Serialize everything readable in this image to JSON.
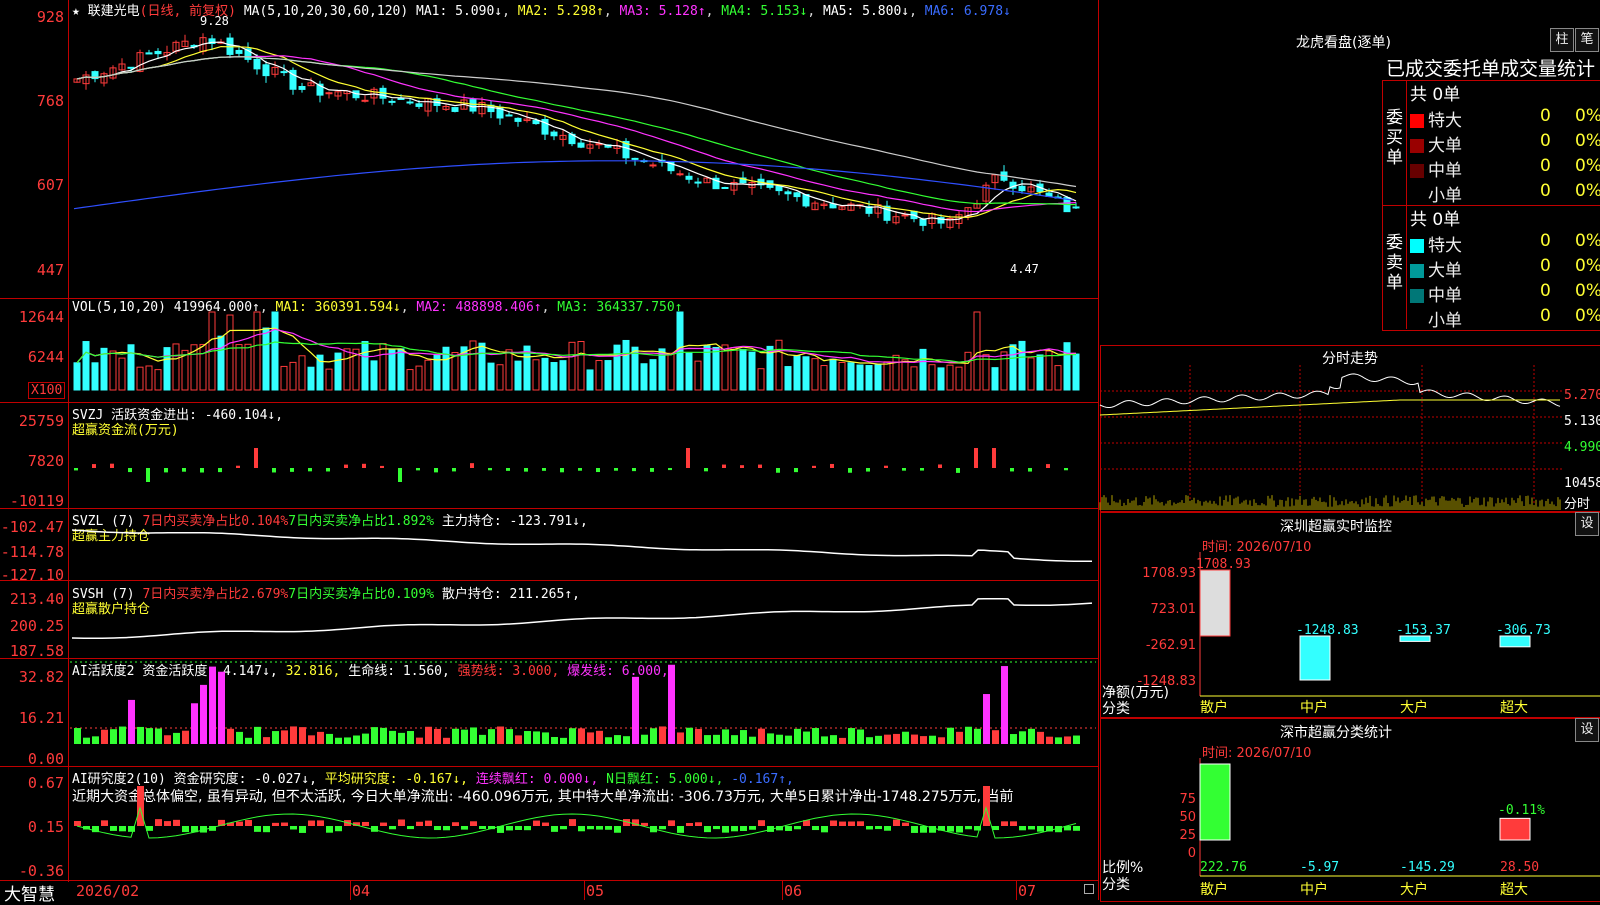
{
  "app": {
    "brand": "大智慧"
  },
  "main": {
    "header": {
      "name": "联建光电",
      "mode": "(日线, 前复权)",
      "ma_title": "MA(5,10,20,30,60,120)",
      "ma1": "MA1: 5.090↓",
      "ma2": "MA2: 5.298↑",
      "ma3": "MA3: 5.128↑",
      "ma4": "MA4: 5.153↓",
      "ma5": "MA5: 5.800↓",
      "ma6": "MA6: 6.978↓"
    },
    "yaxis": [
      "928",
      "768",
      "607",
      "447"
    ],
    "high_label": "9.28",
    "low_label": "4.47",
    "colors": {
      "up": "#ff3b3b",
      "down": "#33ffff",
      "ma1": "#ffffff",
      "ma2": "#ffff33",
      "ma3": "#ff33ff",
      "ma4": "#33ff33",
      "ma5": "#cccccc",
      "ma6": "#2f4fff"
    }
  },
  "vol": {
    "header": {
      "title": "VOL(5,10,20)",
      "value": "419964.000↑",
      "ma1": "MA1: 360391.594↓",
      "ma2": "MA2: 488898.406↑",
      "ma3": "MA3: 364337.750↑"
    },
    "yaxis": [
      "12644",
      "6244"
    ],
    "unit": "X100"
  },
  "svzj": {
    "header": {
      "title": "SVZJ",
      "label": "活跃资金进出: -460.104↓,",
      "sub": "超赢资金流(万元)"
    },
    "yaxis": [
      "25759",
      "7820",
      "-10119"
    ]
  },
  "svzl": {
    "header": {
      "title": "SVZL (7)",
      "a": "7日内买卖净占比0.104%",
      "b": "7日内买卖净占比1.892%",
      "c": "主力持仓: -123.791↓,",
      "sub": "超赢主力持仓"
    },
    "yaxis": [
      "-102.47",
      "-114.78",
      "-127.10"
    ]
  },
  "svsh": {
    "header": {
      "title": "SVSH (7)",
      "a": "7日内买卖净占比2.679%",
      "b": "7日内买卖净占比0.109%",
      "c": "散户持仓: 211.265↑,",
      "sub": "超赢散户持仓"
    },
    "yaxis": [
      "213.40",
      "200.25",
      "187.58"
    ]
  },
  "ai1": {
    "header": {
      "title": "AI活跃度2",
      "a": "资金活跃度: 4.147↓,",
      "b": "32.816,",
      "c": "生命线: 1.560,",
      "d": "强势线: 3.000,",
      "e": "爆发线: 6.000,"
    },
    "yaxis": [
      "32.82",
      "16.21",
      "0.00"
    ]
  },
  "ai2": {
    "header": {
      "title": "AI研究度2(10)",
      "a": "资金研究度: -0.027↓,",
      "b": "平均研究度: -0.167↓,",
      "c": "连续飘红: 0.000↓,",
      "d": "N日飘红: 5.000↓,",
      "e": "-0.167↑,"
    },
    "text": "近期大资金总体偏空, 虽有异动, 但不太活跃, 今日大单净流出: -460.096万元, 其中特大单净流出: -306.73万元, 大单5日累计净出-1748.275万元, 当前",
    "yaxis": [
      "0.67",
      "0.15",
      "-0.36"
    ]
  },
  "xaxis": [
    "2026/02",
    "04",
    "05",
    "06",
    "07"
  ],
  "right": {
    "lhb": {
      "title": "龙虎看盘(逐单)",
      "btn_bar": "柱",
      "btn_pen": "笔",
      "subtitle": "已成交委托单成交量统计",
      "buy_label": "委买单",
      "sell_label": "委卖单",
      "buy_total": "共 0单",
      "sell_total": "共 0单",
      "buy_rows": [
        {
          "name": "特大",
          "val": "0",
          "pct": "0%",
          "color": "#ff0000"
        },
        {
          "name": "大单",
          "val": "0",
          "pct": "0%",
          "color": "#990000"
        },
        {
          "name": "中单",
          "val": "0",
          "pct": "0%",
          "color": "#660000"
        },
        {
          "name": "小单",
          "val": "0",
          "pct": "0%",
          "color": ""
        }
      ],
      "sell_rows": [
        {
          "name": "特大",
          "val": "0",
          "pct": "0%",
          "color": "#00ffff"
        },
        {
          "name": "大单",
          "val": "0",
          "pct": "0%",
          "color": "#009999"
        },
        {
          "name": "中单",
          "val": "0",
          "pct": "0%",
          "color": "#007777"
        },
        {
          "name": "小单",
          "val": "0",
          "pct": "0%",
          "color": ""
        }
      ]
    },
    "fs": {
      "title": "分时走势",
      "p1": "5.270",
      "p2": "5.130",
      "p3": "4.990",
      "v": "10458",
      "unit": "分时"
    },
    "sz": {
      "title": "深圳超赢实时监控",
      "btn": "设",
      "time": "时间: 2026/07/10",
      "yaxis": [
        "1708.93",
        "723.01",
        "-262.91",
        "-1248.83"
      ],
      "ylabel1": "净额(万元)",
      "ylabel2": "分类",
      "bars": [
        {
          "cat": "散户",
          "label": "1708.93",
          "value": 1708.93
        },
        {
          "cat": "中户",
          "label": "-1248.83",
          "value": -1248.83
        },
        {
          "cat": "大户",
          "label": "-153.37",
          "value": -153.37
        },
        {
          "cat": "超大",
          "label": "-306.73",
          "value": -306.73
        }
      ]
    },
    "ss": {
      "title": "深市超赢分类统计",
      "btn": "设",
      "time": "时间: 2026/07/10",
      "yaxis": [
        "75",
        "50",
        "25",
        "0"
      ],
      "ylabel1": "比例%",
      "ylabel2": "分类",
      "top_label": "-0.11%",
      "bars": [
        {
          "cat": "散户",
          "label": "222.76",
          "value": 100
        },
        {
          "cat": "中户",
          "label": "-5.97",
          "value": 0
        },
        {
          "cat": "大户",
          "label": "-145.29",
          "value": 0
        },
        {
          "cat": "超大",
          "label": "28.50",
          "value": 28.5
        }
      ]
    }
  }
}
